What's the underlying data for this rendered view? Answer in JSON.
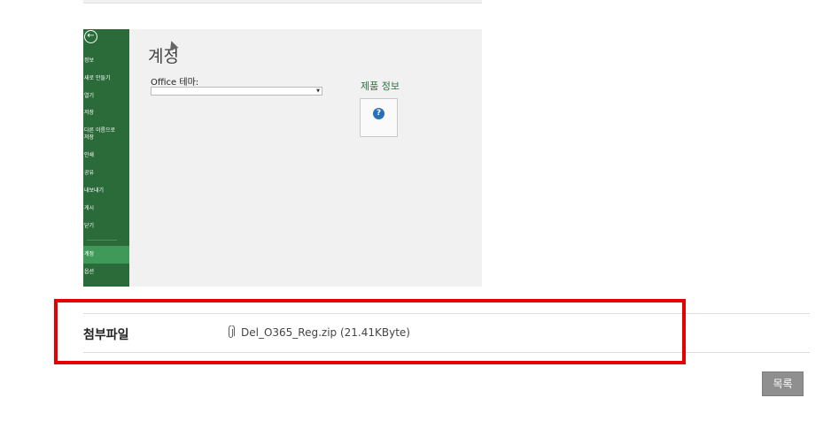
{
  "office": {
    "back_icon": "back-arrow-icon",
    "back_glyph": "←",
    "nav": [
      "정보",
      "새로 만들기",
      "열기",
      "저장",
      "다른 이름으로",
      "저장",
      "인쇄",
      "공유",
      "내보내기",
      "게시",
      "닫기",
      "계정",
      "옵션"
    ],
    "title": "계정",
    "theme_label": "Office 테마:",
    "theme_value": "",
    "product_title": "제품 정보",
    "help_icon": "help-icon",
    "help_glyph": "?",
    "colors": {
      "sidebar": "#2b6b3a",
      "active": "#3f9a59",
      "accent_text": "#2e7044"
    }
  },
  "attachment": {
    "label": "첨부파일",
    "icon": "paperclip-icon",
    "file_text": "Del_O365_Reg.zip (21.41KByte)"
  },
  "highlight_color": "#e60000",
  "list_button": "목록"
}
